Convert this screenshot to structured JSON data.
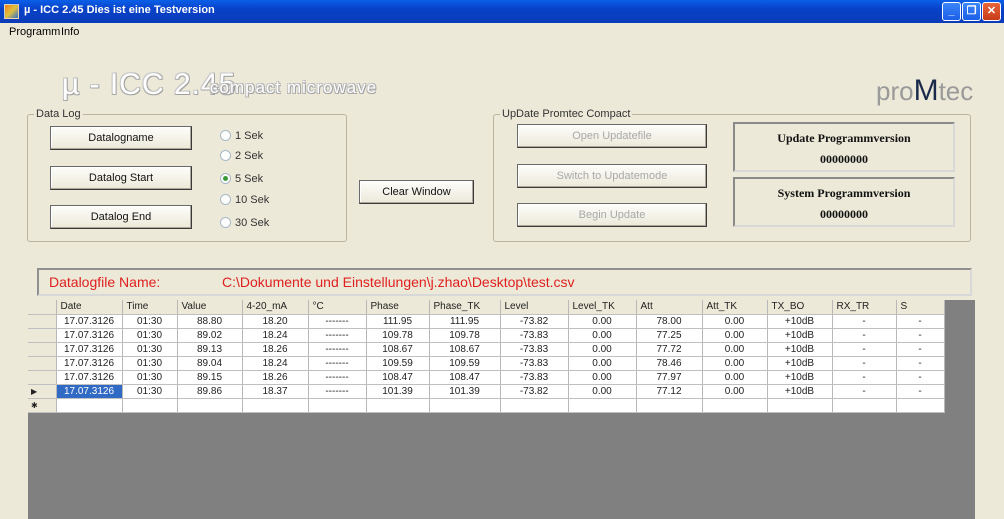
{
  "window": {
    "title": "µ - ICC 2.45  Dies ist eine Testversion",
    "minimize": "_",
    "maximize": "❐",
    "close": "✕"
  },
  "menu": [
    "Programm",
    "Info"
  ],
  "header": {
    "title": "µ - ICC 2.45",
    "subtitle": "compact microwave",
    "logo_pre": "pro",
    "logo_m": "M",
    "logo_post": "tec"
  },
  "datalog": {
    "legend": "Data Log",
    "buttons": {
      "name": "Datalogname",
      "start": "Datalog Start",
      "end": "Datalog End"
    },
    "intervals": [
      "1 Sek",
      "2 Sek",
      "5 Sek",
      "10 Sek",
      "30 Sek"
    ],
    "selected": "5 Sek"
  },
  "clear_window": "Clear Window",
  "update": {
    "legend": "UpDate Promtec Compact",
    "open": "Open Updatefile",
    "switch": "Switch to Updatemode",
    "begin": "Begin Update",
    "prog_label": "Update Programmversion",
    "prog_value": "00000000",
    "sys_label": "System Programmversion",
    "sys_value": "00000000"
  },
  "file": {
    "label": "Datalogfile  Name:",
    "path": "C:\\Dokumente und Einstellungen\\j.zhao\\Desktop\\test.csv"
  },
  "table": {
    "columns": [
      "Date",
      "Time",
      "Value",
      "4-20_mA",
      "°C",
      "Phase",
      "Phase_TK",
      "Level",
      "Level_TK",
      "Att",
      "Att_TK",
      "TX_BO",
      "RX_TR",
      "S"
    ],
    "rows": [
      [
        "17.07.3126",
        "01:30",
        "88.80",
        "18.20",
        "-------",
        "111.95",
        "111.95",
        "-73.82",
        "0.00",
        "78.00",
        "0.00",
        "+10dB",
        "-",
        "-"
      ],
      [
        "17.07.3126",
        "01:30",
        "89.02",
        "18.24",
        "-------",
        "109.78",
        "109.78",
        "-73.83",
        "0.00",
        "77.25",
        "0.00",
        "+10dB",
        "-",
        "-"
      ],
      [
        "17.07.3126",
        "01:30",
        "89.13",
        "18.26",
        "-------",
        "108.67",
        "108.67",
        "-73.83",
        "0.00",
        "77.72",
        "0.00",
        "+10dB",
        "-",
        "-"
      ],
      [
        "17.07.3126",
        "01:30",
        "89.04",
        "18.24",
        "-------",
        "109.59",
        "109.59",
        "-73.83",
        "0.00",
        "78.46",
        "0.00",
        "+10dB",
        "-",
        "-"
      ],
      [
        "17.07.3126",
        "01:30",
        "89.15",
        "18.26",
        "-------",
        "108.47",
        "108.47",
        "-73.83",
        "0.00",
        "77.97",
        "0.00",
        "+10dB",
        "-",
        "-"
      ],
      [
        "17.07.3126",
        "01:30",
        "89.86",
        "18.37",
        "-------",
        "101.39",
        "101.39",
        "-73.82",
        "0.00",
        "77.12",
        "0.00",
        "+10dB",
        "-",
        "-"
      ]
    ],
    "current_marker": "▶",
    "new_marker": "✱"
  },
  "colors": {
    "titlebar": "#0a3cb8",
    "filepath": "#e02020",
    "selection": "#316ac5"
  }
}
